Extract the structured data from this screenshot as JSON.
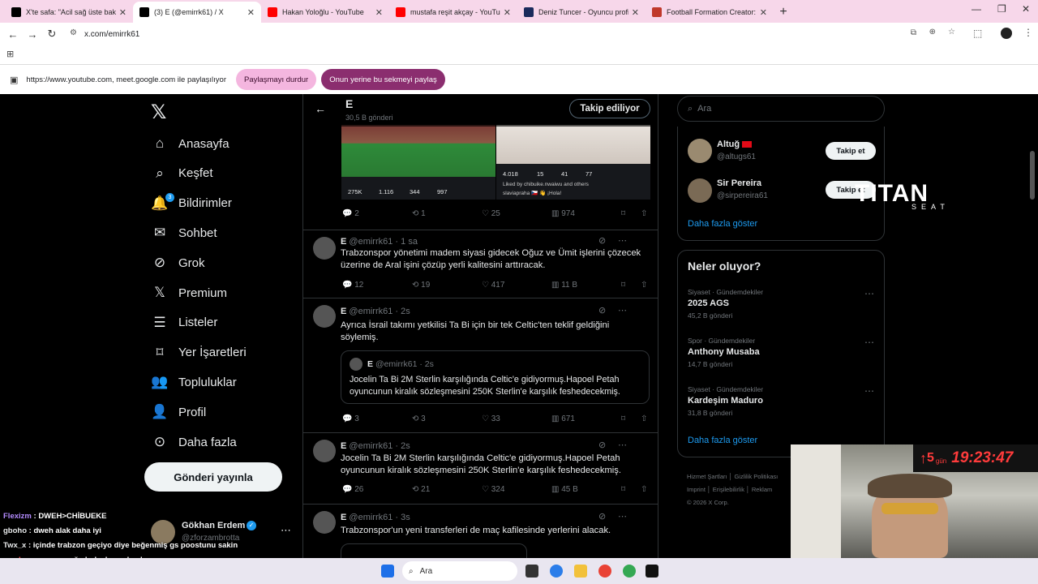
{
  "browser": {
    "tabs": [
      {
        "title": "X'te safa: \"Acil sağ üste bakın h",
        "favicon": "x-icon",
        "color": "#000000"
      },
      {
        "title": "(3) E (@emirrk61) / X",
        "favicon": "x-icon",
        "color": "#000000",
        "active": true
      },
      {
        "title": "Hakan Yoloğlu - YouTube",
        "favicon": "youtube-icon",
        "color": "#ff0000"
      },
      {
        "title": "mustafa reşit akçay - YouTu",
        "favicon": "youtube-icon",
        "color": "#ff0000"
      },
      {
        "title": "Deniz Tuncer - Oyuncu profili 2",
        "favicon": "transfermarkt-icon",
        "color": "#1a2b5c"
      },
      {
        "title": "Football Formation Creator: Re",
        "favicon": "doc-icon",
        "color": "#c0392b"
      }
    ],
    "url": "x.com/emirrk61",
    "share_text": "https://www.youtube.com, meet.google.com ile paylaşılıyor",
    "stop_share_label": "Paylaşmayı durdur",
    "share_tab_label": "Onun yerine bu sekmeyi paylaş"
  },
  "sidebar": {
    "items": [
      {
        "label": "Anasayfa",
        "icon": "home-icon"
      },
      {
        "label": "Keşfet",
        "icon": "search-icon"
      },
      {
        "label": "Bildirimler",
        "icon": "bell-icon",
        "badge": "3"
      },
      {
        "label": "Sohbet",
        "icon": "mail-icon"
      },
      {
        "label": "Grok",
        "icon": "grok-icon"
      },
      {
        "label": "Premium",
        "icon": "x-icon"
      },
      {
        "label": "Listeler",
        "icon": "list-icon"
      },
      {
        "label": "Yer İşaretleri",
        "icon": "bookmark-icon"
      },
      {
        "label": "Topluluklar",
        "icon": "people-icon"
      },
      {
        "label": "Profil",
        "icon": "person-icon"
      },
      {
        "label": "Daha fazla",
        "icon": "more-circle-icon"
      }
    ],
    "post_label": "Gönderi yayınla",
    "account": {
      "name": "Gökhan Erdem",
      "handle": "@zforzambrotta"
    }
  },
  "header": {
    "name": "E",
    "count": "30,5 B gönderi",
    "follow_label": "Takip ediliyor"
  },
  "media": {
    "left_stats": [
      "275K",
      "1.116",
      "344",
      "997"
    ],
    "right_stats": [
      "4.018",
      "15",
      "41",
      "77"
    ],
    "liked_by": "Liked by chibuike.nwaiwu and others",
    "caption": "slaviapraha 🇨🇿 👋 ¡Hola!"
  },
  "posts": [
    {
      "replies": "2",
      "reposts": "1",
      "likes": "25",
      "views": "974"
    },
    {
      "name": "E",
      "handle": "@emirrk61",
      "time": "· 1 sa",
      "text": "Trabzonspor yönetimi madem siyasi gidecek Oğuz ve Ümit işlerini çözecek üzerine de Aral işini çözüp yerli kalitesini arttıracak.",
      "replies": "12",
      "reposts": "19",
      "likes": "417",
      "views": "11 B"
    },
    {
      "name": "E",
      "handle": "@emirrk61",
      "time": "· 2s",
      "text": "Ayrıca İsrail takımı yetkilisi Ta Bi için bir tek Celtic'ten teklif geldiğini söylemiş.",
      "quote": {
        "name": "E",
        "handle": "@emirrk61",
        "time": "· 2s",
        "text": "Jocelin Ta Bi  2M Sterlin karşılığında Celtic'e gidiyormuş.Hapoel Petah oyuncunun  kiralık sözleşmesini 250K Sterlin'e  karşılık feshedecekmiş."
      },
      "replies": "3",
      "reposts": "3",
      "likes": "33",
      "views": "671"
    },
    {
      "name": "E",
      "handle": "@emirrk61",
      "time": "· 2s",
      "text": "Jocelin Ta Bi  2M Sterlin karşılığında Celtic'e gidiyormuş.Hapoel Petah oyuncunun  kiralık sözleşmesini 250K Sterlin'e  karşılık feshedecekmiş.",
      "replies": "26",
      "reposts": "21",
      "likes": "324",
      "views": "45 B"
    },
    {
      "name": "E",
      "handle": "@emirrk61",
      "time": "· 3s",
      "text": "Trabzonspor'un yeni transferleri de maç kafilesinde yerlerini alacak."
    }
  ],
  "right": {
    "search_placeholder": "Ara",
    "follow_suggestions": [
      {
        "name": "Altuğ",
        "handle": "@altugs61",
        "button": "Takip et"
      },
      {
        "name": "Sir Pereira",
        "handle": "@sirpereira61",
        "button": "Takip et"
      }
    ],
    "show_more": "Daha fazla göster",
    "trends_title": "Neler oluyor?",
    "trends": [
      {
        "category": "Siyaset · Gündemdekiler",
        "title": "2025 AGS",
        "count": "45,2 B gönderi"
      },
      {
        "category": "Spor · Gündemdekiler",
        "title": "Anthony Musaba",
        "count": "14,7 B gönderi"
      },
      {
        "category": "Siyaset · Gündemdekiler",
        "title": "Kardeşim Maduro",
        "count": "31,8 B gönderi"
      }
    ],
    "trends_more": "Daha fazla göster",
    "footer": [
      "Hizmet Şartları",
      "Gizlilik Politikası",
      "Imprint",
      "Erişilebilirlik",
      "Reklam",
      "© 2026 X Corp."
    ]
  },
  "overlay": {
    "logo": "TITAN",
    "logo_sub": "SEAT",
    "clock_days": "5",
    "clock_unit": "gün",
    "clock_time": "19:23:47",
    "chat": [
      {
        "user": "Flexizm",
        "text": "DWEH>CHİBUEKE",
        "color": "#b48cff"
      },
      {
        "user": "gboho",
        "text": "dweh alak daha iyi",
        "color": "#e7e9ea"
      },
      {
        "user": "Twx_x",
        "text": "içinde trabzon geçiyo diye beğenmiş gs poostunu sakin",
        "color": "#e7e9ea"
      },
      {
        "user": "cevdemann",
        "text": "yavşağa bok almayalım bunu",
        "color": "#ff4d4d"
      }
    ]
  },
  "taskbar": {
    "search_placeholder": "Ara"
  }
}
